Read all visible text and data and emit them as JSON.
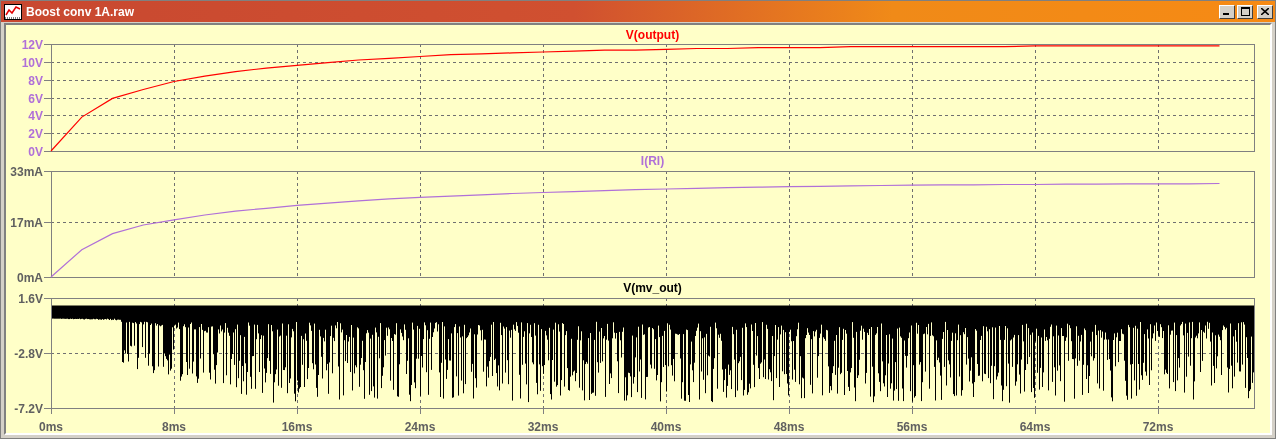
{
  "window": {
    "title": "Boost conv 1A.raw"
  },
  "panes": [
    {
      "kind": "chart",
      "chart_data": {
        "type": "line",
        "categories": [
          null,
          null,
          null,
          null,
          null,
          null,
          null,
          null,
          null,
          null,
          null,
          null,
          null,
          null,
          null,
          null,
          null,
          null,
          null,
          null,
          null,
          null,
          null,
          null,
          null,
          null,
          null,
          null,
          null,
          null,
          null,
          null,
          null,
          null,
          null,
          null,
          null,
          null,
          null
        ],
        "series": [
          {
            "name": "V(output)",
            "color": "#ff0000",
            "values": [
              0,
              3.8,
              5.9,
              6.9,
              7.8,
              8.4,
              8.9,
              9.3,
              9.6,
              9.9,
              10.2,
              10.4,
              10.6,
              10.8,
              10.9,
              11.0,
              11.1,
              11.2,
              11.3,
              11.3,
              11.4,
              11.5,
              11.5,
              11.6,
              11.6,
              11.6,
              11.7,
              11.7,
              11.7,
              11.7,
              11.7,
              11.7,
              11.8,
              11.8,
              11.8,
              11.8,
              11.8,
              11.8,
              11.8
            ]
          }
        ],
        "ylim": [
          0,
          12
        ],
        "grid": true,
        "yticks": [
          {
            "value": 0,
            "label": "0V"
          },
          {
            "value": 2,
            "label": "2V"
          },
          {
            "value": 4,
            "label": "4V"
          },
          {
            "value": 6,
            "label": "6V"
          },
          {
            "value": 8,
            "label": "8V"
          },
          {
            "value": 10,
            "label": "10V"
          },
          {
            "value": 12,
            "label": "12V"
          }
        ]
      }
    },
    {
      "kind": "chart",
      "chart_data": {
        "type": "line",
        "categories": [
          null,
          null,
          null,
          null,
          null,
          null,
          null,
          null,
          null,
          null,
          null,
          null,
          null,
          null,
          null,
          null,
          null,
          null,
          null,
          null,
          null,
          null,
          null,
          null,
          null,
          null,
          null,
          null,
          null,
          null,
          null,
          null,
          null,
          null,
          null,
          null,
          null,
          null,
          null
        ],
        "series": [
          {
            "name": "I(RI)",
            "color": "#b070d8",
            "values": [
              0,
              8.5,
              13.5,
              16.2,
              17.8,
              19.3,
              20.5,
              21.4,
              22.3,
              23,
              23.7,
              24.3,
              24.8,
              25.2,
              25.6,
              26,
              26.3,
              26.6,
              26.9,
              27.2,
              27.4,
              27.6,
              27.8,
              28,
              28.1,
              28.2,
              28.4,
              28.5,
              28.6,
              28.7,
              28.7,
              28.8,
              28.8,
              28.9,
              28.9,
              29,
              29,
              29,
              29.1
            ]
          }
        ],
        "ylim": [
          0,
          33
        ],
        "grid": true,
        "yticks": [
          {
            "value": 0,
            "label": "0mA"
          },
          {
            "value": 17,
            "label": "17mA"
          },
          {
            "value": 33,
            "label": "33mA"
          }
        ]
      }
    },
    {
      "kind": "waveform",
      "title": "V(mv_out)",
      "ytick_labels": [
        "1.6V",
        "-2.8V",
        "-7.2V"
      ]
    }
  ],
  "x_axis": {
    "tick_labels": [
      "0ms",
      "8ms",
      "16ms",
      "24ms",
      "32ms",
      "40ms",
      "48ms",
      "56ms",
      "64ms",
      "72ms"
    ]
  }
}
